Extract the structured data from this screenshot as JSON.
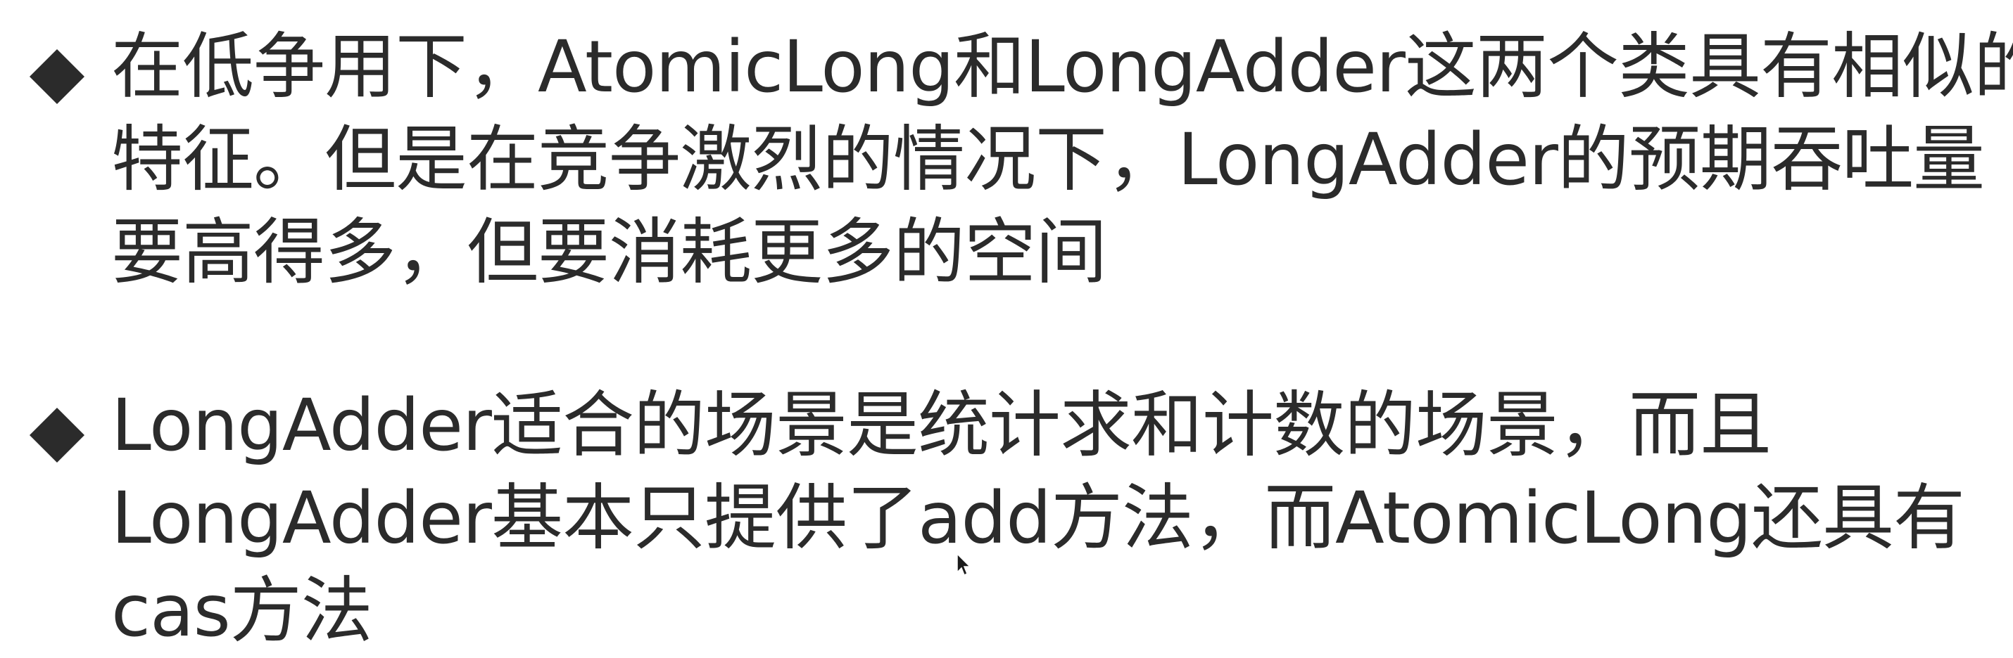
{
  "bullets": [
    {
      "lines": [
        "在低争用下，AtomicLong和LongAdder这两个类具有相似的",
        "特征。但是在竞争激烈的情况下，LongAdder的预期吞吐量",
        "要高得多，但要消耗更多的空间"
      ],
      "icon": "diamond-bullet-icon"
    },
    {
      "lines": [
        "LongAdder适合的场景是统计求和计数的场景，而且",
        "LongAdder基本只提供了add方法，而AtomicLong还具有",
        "cas方法"
      ],
      "icon": "diamond-bullet-icon"
    }
  ],
  "colors": {
    "text": "#2b2b2b",
    "bullet": "#2b2b2b",
    "background": "#ffffff"
  },
  "cursor_icon": "mouse-pointer-icon"
}
